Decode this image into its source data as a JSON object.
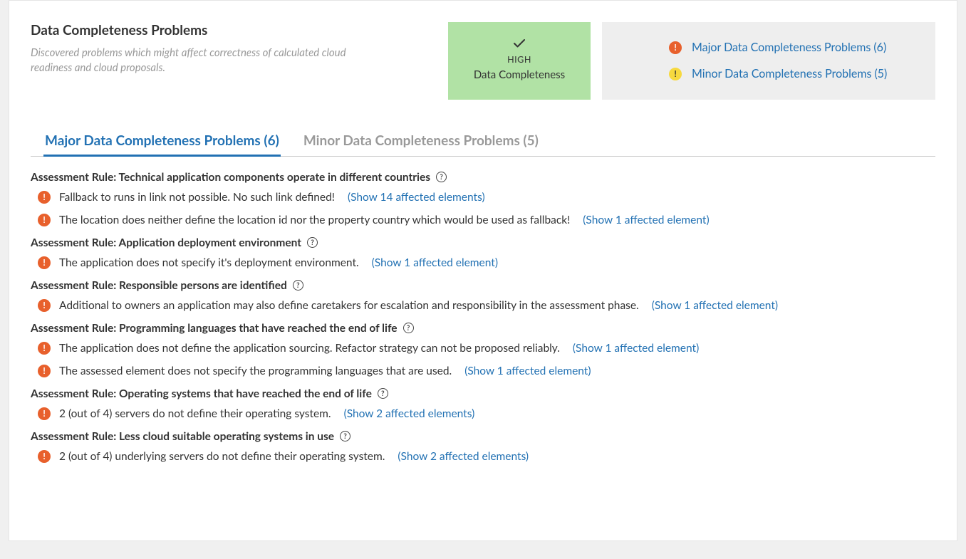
{
  "header": {
    "title": "Data Completeness Problems",
    "subtitle": "Discovered problems which might affect correctness of calculated cloud readiness and cloud proposals."
  },
  "status": {
    "level": "HIGH",
    "kind": "Data Completeness"
  },
  "summary": {
    "major_label": "Major Data Completeness Problems (6)",
    "minor_label": "Minor Data Completeness Problems (5)"
  },
  "tabs": {
    "major": "Major Data Completeness Problems (6)",
    "minor": "Minor Data Completeness Problems (5)"
  },
  "rules": [
    {
      "title": "Assessment Rule: Technical application components operate in different countries",
      "issues": [
        {
          "text": "Fallback to runs in link not possible. No such link defined!",
          "link": "(Show 14 affected elements)"
        },
        {
          "text": "The location does neither define the location id nor the property country which would be used as fallback!",
          "link": "(Show 1 affected element)"
        }
      ]
    },
    {
      "title": "Assessment Rule: Application deployment environment",
      "issues": [
        {
          "text": "The application does not specify it's deployment environment.",
          "link": "(Show 1 affected element)"
        }
      ]
    },
    {
      "title": "Assessment Rule: Responsible persons are identified",
      "issues": [
        {
          "text": "Additional to owners an application may also define caretakers for escalation and responsibility in the assessment phase.",
          "link": "(Show 1 affected element)"
        }
      ]
    },
    {
      "title": "Assessment Rule: Programming languages that have reached the end of life",
      "issues": [
        {
          "text": "The application does not define the application sourcing. Refactor strategy can not be proposed reliably.",
          "link": "(Show 1 affected element)"
        },
        {
          "text": "The assessed element does not specify the programming languages that are used.",
          "link": "(Show 1 affected element)"
        }
      ]
    },
    {
      "title": "Assessment Rule: Operating systems that have reached the end of life",
      "issues": [
        {
          "text": "2 (out of 4) servers do not define their operating system.",
          "link": "(Show 2 affected elements)"
        }
      ]
    },
    {
      "title": "Assessment Rule: Less cloud suitable operating systems in use",
      "issues": [
        {
          "text": "2 (out of 4) underlying servers do not define their operating system.",
          "link": "(Show 2 affected elements)"
        }
      ]
    }
  ]
}
